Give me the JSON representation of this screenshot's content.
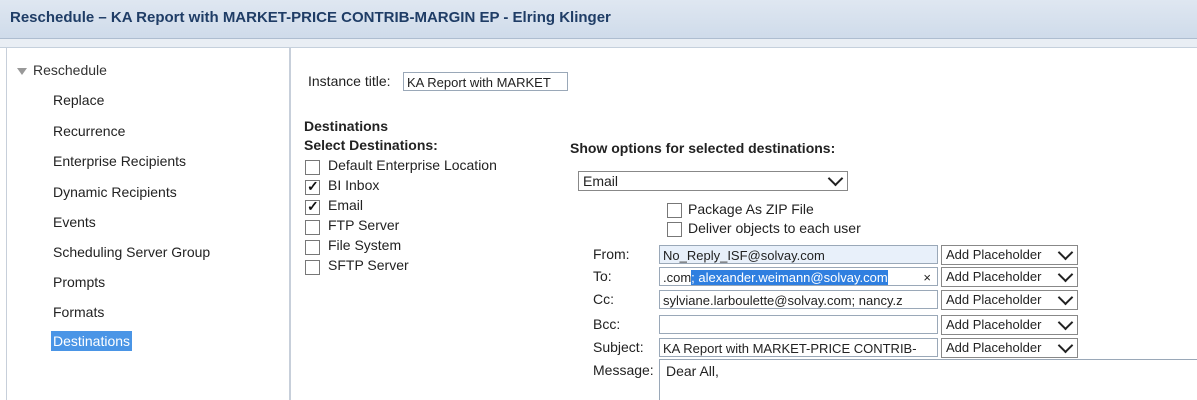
{
  "window": {
    "title": "Reschedule – KA Report with MARKET-PRICE CONTRIB-MARGIN EP - Elring Klinger"
  },
  "sidebar": {
    "root": "Reschedule",
    "items": [
      {
        "label": "Replace"
      },
      {
        "label": "Recurrence"
      },
      {
        "label": "Enterprise Recipients"
      },
      {
        "label": "Dynamic Recipients"
      },
      {
        "label": "Events"
      },
      {
        "label": "Scheduling Server Group"
      },
      {
        "label": "Prompts"
      },
      {
        "label": "Formats"
      },
      {
        "label": "Destinations",
        "selected": true
      }
    ]
  },
  "main": {
    "instance_title_label": "Instance title:",
    "instance_title_value": "KA Report with MARKET",
    "destinations_heading": "Destinations",
    "select_destinations_heading": "Select Destinations:",
    "destinations": [
      {
        "label": "Default Enterprise Location",
        "checked": false
      },
      {
        "label": "BI Inbox",
        "checked": true
      },
      {
        "label": "Email",
        "checked": true
      },
      {
        "label": "FTP Server",
        "checked": false
      },
      {
        "label": "File System",
        "checked": false
      },
      {
        "label": "SFTP Server",
        "checked": false
      }
    ],
    "show_options_heading": "Show options for selected destinations:",
    "destination_select": "Email",
    "package_zip_label": "Package As ZIP File",
    "deliver_each_label": "Deliver objects to each user",
    "email": {
      "from_label": "From:",
      "from_value": "No_Reply_ISF@solvay.com",
      "to_label": "To:",
      "to_value_prefix": ".com",
      "to_value_selected": "; alexander.weimann@solvay.com",
      "to_clear": "×",
      "cc_label": "Cc:",
      "cc_value": "sylviane.larboulette@solvay.com; nancy.z",
      "bcc_label": "Bcc:",
      "bcc_value": "",
      "subject_label": "Subject:",
      "subject_value": "KA Report with MARKET-PRICE CONTRIB-",
      "message_label": "Message:",
      "message_value": "Dear All,",
      "placeholder_button": "Add Placeholder"
    }
  }
}
